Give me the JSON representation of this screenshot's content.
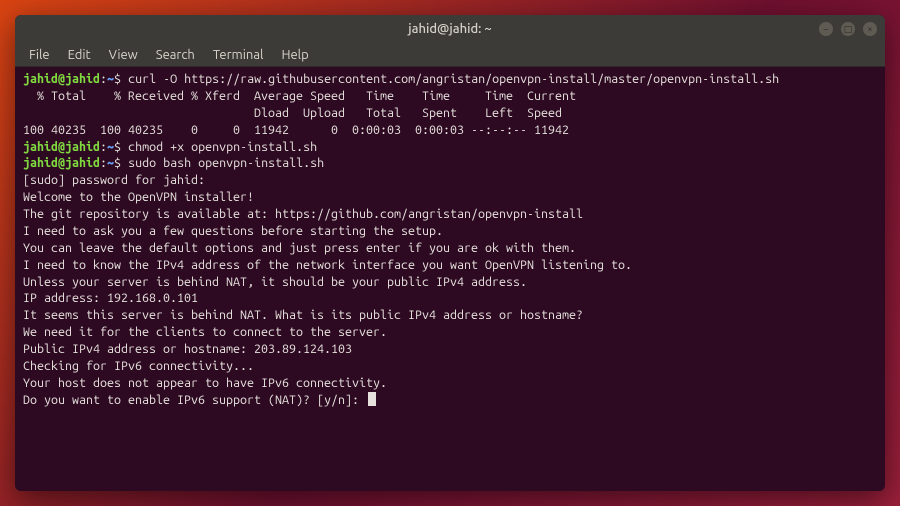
{
  "titlebar": {
    "title": "jahid@jahid: ~"
  },
  "window_controls": {
    "min": "–",
    "max": "□",
    "close": "×"
  },
  "menubar": {
    "items": [
      "File",
      "Edit",
      "View",
      "Search",
      "Terminal",
      "Help"
    ]
  },
  "prompt": {
    "user_host": "jahid@jahid",
    "sep1": ":",
    "path": "~",
    "sep2": "$ "
  },
  "lines": {
    "cmd1": "curl -O https://raw.githubusercontent.com/angristan/openvpn-install/master/openvpn-install.sh",
    "curl_hdr1": "  % Total    % Received % Xferd  Average Speed   Time    Time     Time  Current",
    "curl_hdr2": "                                 Dload  Upload   Total   Spent    Left  Speed",
    "curl_row": "100 40235  100 40235    0     0  11942      0  0:00:03  0:00:03 --:--:-- 11942",
    "cmd2": "chmod +x openvpn-install.sh",
    "cmd3": "sudo bash openvpn-install.sh",
    "sudo": "[sudo] password for jahid:",
    "l1": "Welcome to the OpenVPN installer!",
    "l2": "The git repository is available at: https://github.com/angristan/openvpn-install",
    "blank": "",
    "l3": "I need to ask you a few questions before starting the setup.",
    "l4": "You can leave the default options and just press enter if you are ok with them.",
    "l5": "I need to know the IPv4 address of the network interface you want OpenVPN listening to.",
    "l6": "Unless your server is behind NAT, it should be your public IPv4 address.",
    "l7": "IP address: 192.168.0.101",
    "l8": "It seems this server is behind NAT. What is its public IPv4 address or hostname?",
    "l9": "We need it for the clients to connect to the server.",
    "l10": "Public IPv4 address or hostname: 203.89.124.103",
    "l11": "Checking for IPv6 connectivity...",
    "l12": "Your host does not appear to have IPv6 connectivity.",
    "l13": "Do you want to enable IPv6 support (NAT)? [y/n]: "
  }
}
